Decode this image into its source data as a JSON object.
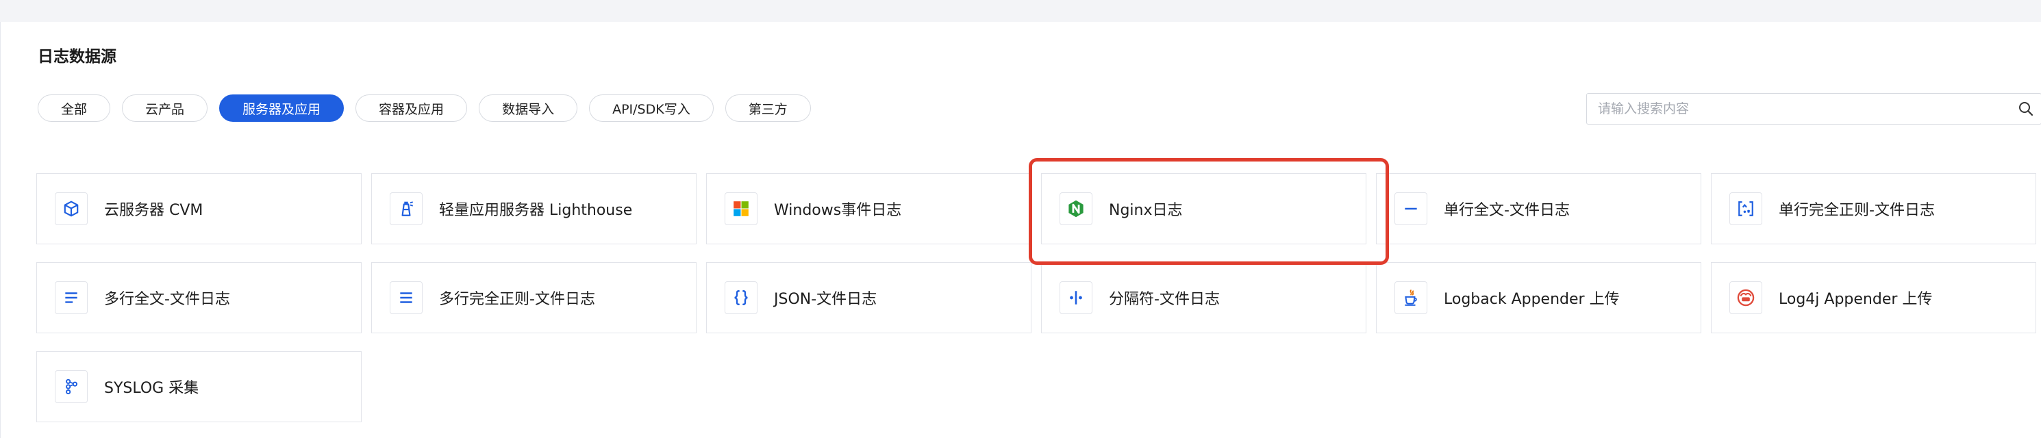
{
  "section": {
    "title": "日志数据源"
  },
  "filters": [
    {
      "label": "全部",
      "active": false
    },
    {
      "label": "云产品",
      "active": false
    },
    {
      "label": "服务器及应用",
      "active": true
    },
    {
      "label": "容器及应用",
      "active": false
    },
    {
      "label": "数据导入",
      "active": false
    },
    {
      "label": "API/SDK写入",
      "active": false
    },
    {
      "label": "第三方",
      "active": false
    }
  ],
  "search": {
    "placeholder": "请输入搜索内容",
    "value": "",
    "icon": "search-icon"
  },
  "sources": [
    {
      "label": "云服务器 CVM",
      "icon": "cvm-icon"
    },
    {
      "label": "轻量应用服务器 Lighthouse",
      "icon": "lighthouse-icon"
    },
    {
      "label": "Windows事件日志",
      "icon": "windows-icon"
    },
    {
      "label": "Nginx日志",
      "icon": "nginx-icon"
    },
    {
      "label": "单行全文-文件日志",
      "icon": "single-line-icon"
    },
    {
      "label": "单行完全正则-文件日志",
      "icon": "regex-icon"
    },
    {
      "label": "多行全文-文件日志",
      "icon": "multi-line-icon"
    },
    {
      "label": "多行完全正则-文件日志",
      "icon": "multi-line-regex-icon"
    },
    {
      "label": "JSON-文件日志",
      "icon": "json-braces-icon"
    },
    {
      "label": "分隔符-文件日志",
      "icon": "delimiter-icon"
    },
    {
      "label": "Logback Appender 上传",
      "icon": "java-cup-icon"
    },
    {
      "label": "Log4j Appender 上传",
      "icon": "log4j-icon"
    },
    {
      "label": "SYSLOG 采集",
      "icon": "syslog-icon"
    }
  ],
  "highlighted_source": "Nginx日志",
  "colors": {
    "accent": "#1f5fe0",
    "highlight": "#e03c2c",
    "nginx_green": "#2a9a3e",
    "log4j_red": "#e04a3a"
  }
}
